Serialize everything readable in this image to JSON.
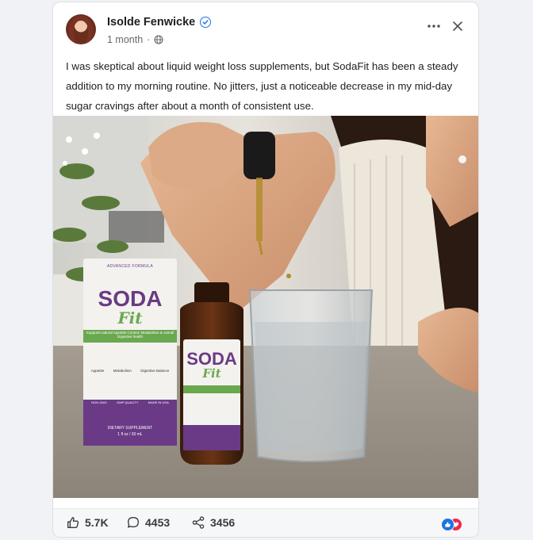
{
  "post": {
    "author": "Isolde Fenwicke",
    "time": "1 month",
    "text": "I was skeptical about liquid weight loss supplements, but SodaFit has been a steady addition to my morning routine. No jitters, just a noticeable decrease in my mid-day sugar cravings after about a month of consistent use.",
    "visibility_icon": "globe-icon",
    "verified_icon": "verified-check-icon"
  },
  "image": {
    "box_label": "ADVANCED FORMULA",
    "brand_top": "SODA",
    "brand_bottom": "Fit",
    "tagline": "Supports natural Appetite Control, Metabolism & overall Digestive health",
    "features": [
      "Appetite",
      "Metabolism",
      "Digestive Balance"
    ],
    "badges": [
      "NON GMO",
      "GMP QUALITY",
      "MADE IN USA"
    ],
    "supplement_line": "DIETARY SUPPLEMENT",
    "volume_line": "1 fl oz / 30 mL"
  },
  "footer": {
    "likes": "5.7K",
    "comments": "4453",
    "shares": "3456"
  },
  "colors": {
    "brand_purple": "#6a3a86",
    "brand_green": "#6aa84f",
    "link_blue": "#1b74e4"
  }
}
